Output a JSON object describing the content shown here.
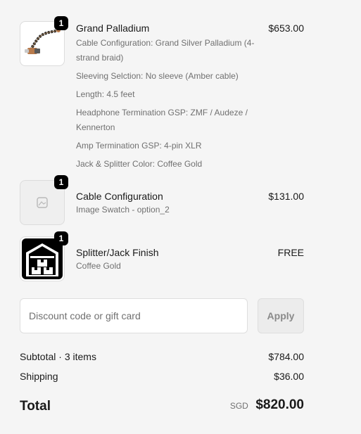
{
  "items": [
    {
      "title": "Grand Palladium",
      "price": "$653.00",
      "quantity": "1",
      "options": [
        "Cable Configuration: Grand Silver Palladium (4-strand braid)",
        "Sleeving Selction: No sleeve (Amber cable)",
        "Length: 4.5 feet",
        "Headphone Termination GSP: ZMF / Audeze / Kennerton",
        "Amp Termination GSP: 4-pin XLR",
        "Jack & Splitter Color: Coffee Gold"
      ]
    },
    {
      "title": "Cable Configuration",
      "price": "$131.00",
      "quantity": "1",
      "options": [
        "Image Swatch - option_2"
      ]
    },
    {
      "title": "Splitter/Jack Finish",
      "price": "FREE",
      "quantity": "1",
      "options": [
        "Coffee Gold"
      ]
    }
  ],
  "discount": {
    "placeholder": "Discount code or gift card",
    "apply_label": "Apply"
  },
  "subtotal": {
    "label": "Subtotal · 3 items",
    "value": "$784.00"
  },
  "shipping": {
    "label": "Shipping",
    "value": "$36.00"
  },
  "total": {
    "label": "Total",
    "currency": "SGD",
    "value": "$820.00"
  },
  "colors": {
    "background": "#f5f5f5",
    "text": "#1a1a1a",
    "muted": "#707070",
    "badge": "#000000",
    "border": "#dedede"
  },
  "icons": [
    "cable-product-image",
    "image-placeholder-icon",
    "warehouse-icon"
  ]
}
